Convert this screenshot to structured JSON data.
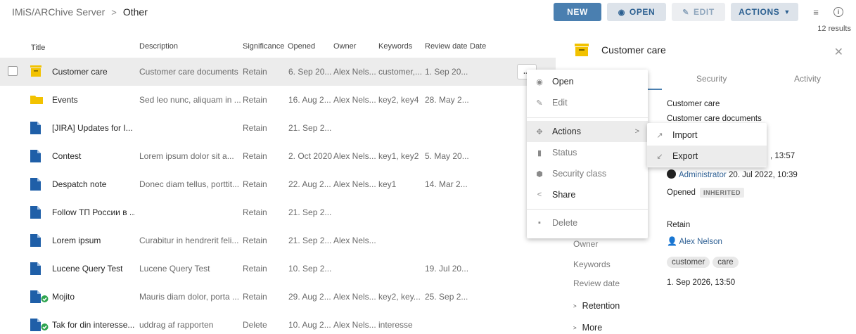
{
  "breadcrumb": {
    "root": "IMiS/ARChive Server",
    "separator": ">",
    "current": "Other"
  },
  "toolbar": {
    "new_label": "NEW",
    "open_label": "OPEN",
    "edit_label": "EDIT",
    "actions_label": "ACTIONS",
    "list_icon": "≡",
    "info_icon": "i",
    "results": "12 results"
  },
  "table": {
    "columns": {
      "title": "Title",
      "sort_icon": "↑",
      "description": "Description",
      "significance": "Significance",
      "opened": "Opened",
      "owner": "Owner",
      "keywords": "Keywords",
      "review_date": "Review date",
      "date": "Date"
    },
    "rows": [
      {
        "title": "Customer care",
        "description": "Customer care documents",
        "significance": "Retain",
        "opened": "6. Sep 20...",
        "owner": "Alex Nels...",
        "keywords": "customer,...",
        "review": "1. Sep 20...",
        "icon": "box-icon",
        "selected": true
      },
      {
        "title": "Events",
        "description": "Sed leo nunc, aliquam in ...",
        "significance": "Retain",
        "opened": "16. Aug 2...",
        "owner": "Alex Nels...",
        "keywords": "key2, key4",
        "review": "28. May 2...",
        "icon": "folder-icon"
      },
      {
        "title": "[JIRA] Updates for I...",
        "description": "",
        "significance": "Retain",
        "opened": "21. Sep 2...",
        "owner": "",
        "keywords": "",
        "review": "",
        "icon": "document-icon"
      },
      {
        "title": "Contest",
        "description": "Lorem ipsum dolor sit a...",
        "significance": "Retain",
        "opened": "2. Oct 2020",
        "owner": "Alex Nels...",
        "keywords": "key1, key2",
        "review": "5. May 20...",
        "icon": "document-icon"
      },
      {
        "title": "Despatch note",
        "description": "Donec diam tellus, porttit...",
        "significance": "Retain",
        "opened": "22. Aug 2...",
        "owner": "Alex Nels...",
        "keywords": "key1",
        "review": "14. Mar 2...",
        "icon": "document-icon"
      },
      {
        "title": "Follow ТП России в ...",
        "description": "",
        "significance": "Retain",
        "opened": "21. Sep 2...",
        "owner": "",
        "keywords": "",
        "review": "",
        "icon": "document-icon"
      },
      {
        "title": "Lorem ipsum",
        "description": "Curabitur in hendrerit feli...",
        "significance": "Retain",
        "opened": "21. Sep 2...",
        "owner": "Alex Nels...",
        "keywords": "",
        "review": "",
        "icon": "document-icon"
      },
      {
        "title": "Lucene Query Test",
        "description": "Lucene Query Test",
        "significance": "Retain",
        "opened": "10. Sep 2...",
        "owner": "",
        "keywords": "",
        "review": "19. Jul 20...",
        "icon": "document-icon"
      },
      {
        "title": "Mojito",
        "description": "Mauris diam dolor, porta ...",
        "significance": "Retain",
        "opened": "29. Aug 2...",
        "owner": "Alex Nels...",
        "keywords": "key2, key...",
        "review": "25. Sep 2...",
        "icon": "document-check-icon"
      },
      {
        "title": "Tak for din interesse...",
        "description": "uddrag af rapporten",
        "significance": "Delete",
        "opened": "10. Aug 2...",
        "owner": "Alex Nels...",
        "keywords": "interesse",
        "review": "",
        "icon": "document-check-icon"
      }
    ],
    "more_label": "..."
  },
  "panel": {
    "title": "Customer care",
    "tabs": {
      "security": "Security",
      "activity": "Activity"
    },
    "title_value": "Customer care",
    "description_value": "Customer care documents",
    "modified_time": ", 13:57",
    "created_by": "Administrator",
    "created_time": "20. Jul 2022, 10:39",
    "status_value": "Opened",
    "status_badge": "INHERITED",
    "significance_value": "Retain",
    "owner_label": "Owner",
    "owner_value": "Alex Nelson",
    "keywords_label": "Keywords",
    "keywords": [
      "customer",
      "care"
    ],
    "review_label": "Review date",
    "review_value": "1. Sep 2026, 13:50",
    "retention_label": "Retention",
    "more_label": "More",
    "accent": "#4a7fb0",
    "box_color": "#f2c200"
  },
  "context_menu": {
    "open": "Open",
    "edit": "Edit",
    "actions": "Actions",
    "status": "Status",
    "security_class": "Security class",
    "share": "Share",
    "delete": "Delete"
  },
  "submenu": {
    "import": "Import",
    "export": "Export"
  }
}
